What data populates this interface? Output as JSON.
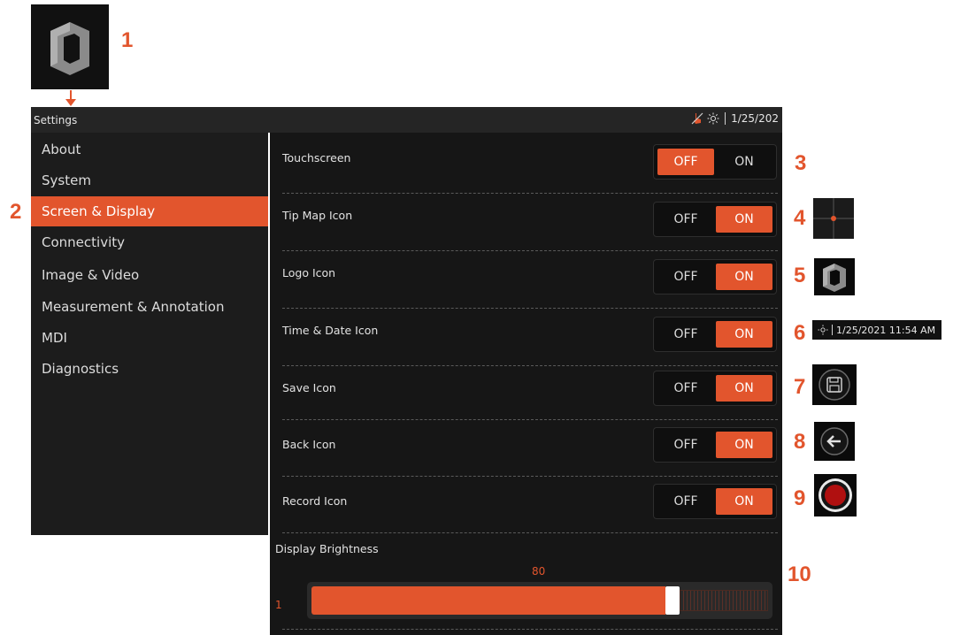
{
  "callouts": {
    "c1": "1",
    "c2": "2",
    "c3": "3",
    "c4": "4",
    "c5": "5",
    "c6": "6",
    "c7": "7",
    "c8": "8",
    "c9": "9",
    "c10": "10"
  },
  "titlebar": {
    "title": "Settings",
    "icons": [
      "touch-icon",
      "brightness-icon"
    ],
    "datetime": "1/25/202"
  },
  "sidebar": {
    "items": [
      {
        "label": "About",
        "active": false
      },
      {
        "label": "System",
        "active": false
      },
      {
        "label": "Screen & Display",
        "active": true
      },
      {
        "label": "Connectivity",
        "active": false
      },
      {
        "label": "Image & Video",
        "active": false
      },
      {
        "label": "Measurement & Annotation",
        "active": false
      },
      {
        "label": "MDI",
        "active": false
      },
      {
        "label": "Diagnostics",
        "active": false
      }
    ]
  },
  "settings": {
    "off_label": "OFF",
    "on_label": "ON",
    "rows": [
      {
        "label": "Touchscreen",
        "value": "OFF"
      },
      {
        "label": "Tip Map Icon",
        "value": "ON"
      },
      {
        "label": "Logo Icon",
        "value": "ON"
      },
      {
        "label": "Time & Date Icon",
        "value": "ON"
      },
      {
        "label": "Save Icon",
        "value": "ON"
      },
      {
        "label": "Back Icon",
        "value": "ON"
      },
      {
        "label": "Record Icon",
        "value": "ON"
      }
    ]
  },
  "brightness": {
    "label": "Display Brightness",
    "value": "80",
    "min": "1",
    "level_fraction": 0.8
  },
  "samples": {
    "datetime_stamp": "1/25/2021 11:54 AM"
  },
  "colors": {
    "accent": "#e2552d",
    "background": "#161616",
    "sidebar": "#1c1c1c",
    "record_red": "#b01010"
  }
}
